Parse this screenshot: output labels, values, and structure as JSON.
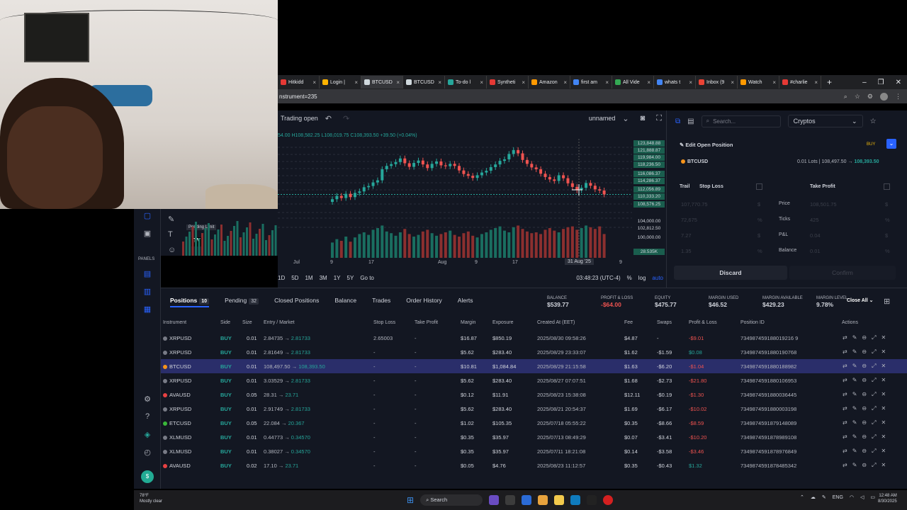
{
  "browser": {
    "tabs": [
      {
        "label": "Hitkidd",
        "color": "#e53935"
      },
      {
        "label": "Login |",
        "color": "#ffb300"
      },
      {
        "label": "BTCUSD",
        "color": "#cfd8dc"
      },
      {
        "label": "BTCUSD",
        "color": "#cfd8dc"
      },
      {
        "label": "To-do l",
        "color": "#26a69a"
      },
      {
        "label": "Syntheti",
        "color": "#e53935"
      },
      {
        "label": "Amazon",
        "color": "#ff9900"
      },
      {
        "label": "first am",
        "color": "#4285f4"
      },
      {
        "label": "All Vide",
        "color": "#34a853"
      },
      {
        "label": "whats t",
        "color": "#4285f4"
      },
      {
        "label": "Inbox (9",
        "color": "#ea4335"
      },
      {
        "label": "Watch",
        "color": "#ff9900"
      },
      {
        "label": "#charlie",
        "color": "#e53935"
      }
    ],
    "url": "nstrument=235"
  },
  "chart": {
    "trading_status": "Trading open",
    "layout_name": "unnamed",
    "ohlc": "54.00 H108,582.25 L108,019.75 C108,393.50 +39.50 (+0.04%)",
    "pending_limit": "Pending Limit",
    "price_labels": [
      "123,848.88",
      "121,888.87",
      "119,984.00",
      "118,236.50",
      "116,086.37",
      "114,286.37",
      "112,056.89",
      "110,333.20",
      "108,576.25",
      "104,000.00",
      "102,812.50",
      "100,000.00",
      "28.535K"
    ],
    "time_labels": [
      "9",
      "17",
      "Jul",
      "9",
      "17",
      "Aug",
      "9",
      "17",
      "31 Aug '25",
      "9"
    ],
    "ranges": [
      "1D",
      "5D",
      "1M",
      "3M",
      "1Y",
      "5Y",
      "Go to"
    ],
    "clock": "03:48:23 (UTC-4)",
    "scale_opts": [
      "%",
      "log",
      "auto"
    ]
  },
  "chart_data": {
    "type": "candlestick",
    "series": [
      {
        "name": "BTCUSD",
        "close": [
          106800,
          107900,
          107200,
          108600,
          107500,
          108900,
          109400,
          110800,
          111200,
          112400,
          113100,
          116800,
          117900,
          118500,
          119200,
          120400,
          118800,
          117600,
          118900,
          119700,
          118400,
          117200,
          118600,
          119400,
          118100,
          117800,
          118600,
          117900,
          116400,
          115200,
          114600,
          113900,
          114800,
          115700,
          116300,
          117500,
          118400,
          119600,
          120100,
          121900,
          123200,
          122100,
          119900,
          118600,
          117400,
          116800,
          115300,
          114200,
          113400,
          112900,
          114800,
          113800,
          112100,
          110900,
          109800,
          110600,
          112200,
          111300,
          110100,
          109700,
          108400
        ]
      },
      {
        "name": "Volume",
        "values": [
          18,
          22,
          20,
          25,
          19,
          24,
          28,
          30,
          27,
          33,
          35,
          38,
          31,
          29,
          26,
          30,
          34,
          28,
          25,
          27,
          31,
          33,
          29,
          26,
          28,
          30,
          32,
          27,
          25,
          29,
          31,
          26,
          24,
          28,
          30,
          33,
          35,
          37,
          32,
          30,
          36,
          38,
          34,
          31,
          29,
          30,
          28,
          33,
          35,
          32,
          30,
          34,
          36,
          37,
          33,
          35,
          38,
          36,
          34,
          37,
          28
        ]
      }
    ],
    "ylim": [
      100000,
      126000
    ]
  },
  "order_panel": {
    "search_placeholder": "Search...",
    "category": "Cryptos",
    "title": "Edit Open Position",
    "side_badge": "BUY",
    "symbol": "BTCUSD",
    "lots_text": "0.01 Lots | 108,497.50 →",
    "current_price": "108,393.50",
    "trail_label": "Trail",
    "stop_loss_label": "Stop Loss",
    "take_profit_label": "Take Profit",
    "sl_fields": [
      "107,770.75",
      "72,675",
      "7.27",
      "1.35"
    ],
    "tp_fields": [
      "108,501.75",
      "425",
      "0.04",
      "0.01"
    ],
    "row_labels": [
      "Price",
      "Ticks",
      "P&L",
      "Balance"
    ],
    "units": [
      "$",
      "%",
      "$",
      "%"
    ],
    "discard": "Discard",
    "confirm": "Confirm"
  },
  "bottom": {
    "tabs": [
      {
        "label": "Positions",
        "count": "10"
      },
      {
        "label": "Pending",
        "count": "32"
      },
      {
        "label": "Closed Positions",
        "count": ""
      },
      {
        "label": "Balance",
        "count": ""
      },
      {
        "label": "Trades",
        "count": ""
      },
      {
        "label": "Order History",
        "count": ""
      },
      {
        "label": "Alerts",
        "count": ""
      }
    ],
    "summary": [
      {
        "label": "BALANCE",
        "value": "$539.77",
        "neg": false
      },
      {
        "label": "PROFIT & LOSS",
        "value": "-$64.00",
        "neg": true
      },
      {
        "label": "EQUITY",
        "value": "$475.77",
        "neg": false
      },
      {
        "label": "MARGIN USED",
        "value": "$46.52",
        "neg": false
      },
      {
        "label": "MARGIN AVAILABLE",
        "value": "$429.23",
        "neg": false
      },
      {
        "label": "MARGIN LEVEL",
        "value": "9.78%",
        "neg": false
      }
    ],
    "close_all": "Close All",
    "headers": [
      "Instrument",
      "Side",
      "Size",
      "Entry / Market",
      "Stop Loss",
      "Take Profit",
      "Margin",
      "Exposure",
      "Created At (EET)",
      "Fee",
      "Swaps",
      "Profit & Loss",
      "Position ID",
      "Actions"
    ],
    "rows": [
      {
        "inst": "XRPUSD",
        "color": "#787b86",
        "side": "BUY",
        "size": "0.01",
        "entry": "2.84735",
        "market": "2.81733",
        "sl": "2.65003",
        "tp": "-",
        "margin": "$16.87",
        "exposure": "$850.19",
        "created": "2025/08/30 09:58:26",
        "fee": "$4.87",
        "swaps": "-",
        "pnl": "-$9.01",
        "pnl_neg": true,
        "id": "734987459188019216 9"
      },
      {
        "inst": "XRPUSD",
        "color": "#787b86",
        "side": "BUY",
        "size": "0.01",
        "entry": "2.81649",
        "market": "2.81733",
        "sl": "-",
        "tp": "-",
        "margin": "$5.62",
        "exposure": "$283.40",
        "created": "2025/08/29 23:33:07",
        "fee": "$1.62",
        "swaps": "-$1.59",
        "pnl": "$0.08",
        "pnl_neg": false,
        "id": "7349874591880190768"
      },
      {
        "inst": "BTCUSD",
        "color": "#f7931a",
        "side": "BUY",
        "size": "0.01",
        "entry": "108,497.50",
        "market": "108,393.50",
        "sl": "-",
        "tp": "-",
        "margin": "$10.81",
        "exposure": "$1,084.84",
        "created": "2025/08/29 21:15:58",
        "fee": "$1.63",
        "swaps": "-$6.20",
        "pnl": "-$1.04",
        "pnl_neg": true,
        "id": "7349874591880188982",
        "sel": true
      },
      {
        "inst": "XRPUSD",
        "color": "#787b86",
        "side": "BUY",
        "size": "0.01",
        "entry": "3.03529",
        "market": "2.81733",
        "sl": "-",
        "tp": "-",
        "margin": "$5.62",
        "exposure": "$283.40",
        "created": "2025/08/27 07:07:51",
        "fee": "$1.68",
        "swaps": "-$2.73",
        "pnl": "-$21.80",
        "pnl_neg": true,
        "id": "7349874591880106953"
      },
      {
        "inst": "AVAUSD",
        "color": "#e84142",
        "side": "BUY",
        "size": "0.05",
        "entry": "28.31",
        "market": "23.71",
        "sl": "-",
        "tp": "-",
        "margin": "$0.12",
        "exposure": "$11.91",
        "created": "2025/08/23 15:38:08",
        "fee": "$12.11",
        "swaps": "-$0.19",
        "pnl": "-$1.30",
        "pnl_neg": true,
        "id": "7349874591880036445"
      },
      {
        "inst": "XRPUSD",
        "color": "#787b86",
        "side": "BUY",
        "size": "0.01",
        "entry": "2.91749",
        "market": "2.81733",
        "sl": "-",
        "tp": "-",
        "margin": "$5.62",
        "exposure": "$283.40",
        "created": "2025/08/21 20:54:37",
        "fee": "$1.69",
        "swaps": "-$6.17",
        "pnl": "-$10.02",
        "pnl_neg": true,
        "id": "7349874591880003198"
      },
      {
        "inst": "ETCUSD",
        "color": "#3ab83a",
        "side": "BUY",
        "size": "0.05",
        "entry": "22.084",
        "market": "20.367",
        "sl": "-",
        "tp": "-",
        "margin": "$1.02",
        "exposure": "$105.35",
        "created": "2025/07/18 05:55:22",
        "fee": "$0.35",
        "swaps": "-$8.66",
        "pnl": "-$8.59",
        "pnl_neg": true,
        "id": "7349874591879148089"
      },
      {
        "inst": "XLMUSD",
        "color": "#787b86",
        "side": "BUY",
        "size": "0.01",
        "entry": "0.44773",
        "market": "0.34570",
        "sl": "-",
        "tp": "-",
        "margin": "$0.35",
        "exposure": "$35.97",
        "created": "2025/07/13 08:49:29",
        "fee": "$0.07",
        "swaps": "-$3.41",
        "pnl": "-$10.20",
        "pnl_neg": true,
        "id": "7349874591878989108"
      },
      {
        "inst": "XLMUSD",
        "color": "#787b86",
        "side": "BUY",
        "size": "0.01",
        "entry": "0.38027",
        "market": "0.34570",
        "sl": "-",
        "tp": "-",
        "margin": "$0.35",
        "exposure": "$35.97",
        "created": "2025/07/11 18:21:08",
        "fee": "$0.14",
        "swaps": "-$3.58",
        "pnl": "-$3.46",
        "pnl_neg": true,
        "id": "7349874591878976849"
      },
      {
        "inst": "AVAUSD",
        "color": "#e84142",
        "side": "BUY",
        "size": "0.02",
        "entry": "17.10",
        "market": "23.71",
        "sl": "-",
        "tp": "-",
        "margin": "$0.05",
        "exposure": "$4.76",
        "created": "2025/08/23 11:12:57",
        "fee": "$0.35",
        "swaps": "-$0.43",
        "pnl": "$1.32",
        "pnl_neg": false,
        "id": "7349874591878485342"
      }
    ]
  },
  "taskbar": {
    "weather_temp": "78°F",
    "weather_desc": "Mostly clear",
    "search": "Search",
    "lang": "ENG",
    "time": "12:48 AM",
    "date": "8/30/2025"
  }
}
